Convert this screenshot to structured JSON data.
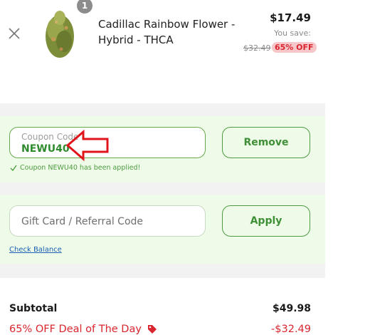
{
  "cart_item": {
    "quantity": "1",
    "title": "Cadillac Rainbow Flower - Hybrid - THCA",
    "price": "$17.49",
    "you_save_label": "You save:",
    "original_price": "$32.49",
    "discount_badge": "65% OFF"
  },
  "coupon": {
    "label": "Coupon Code",
    "value": "NEWU40",
    "button_label": "Remove",
    "applied_message": "Coupon NEWU40 has been applied!"
  },
  "gift_card": {
    "placeholder": "Gift Card / Referral Code",
    "button_label": "Apply",
    "check_balance_link": "Check Balance"
  },
  "totals": {
    "subtotal_label": "Subtotal",
    "subtotal_value": "$49.98",
    "deal_label": "65% OFF Deal of The Day",
    "deal_value": "-$32.49"
  },
  "colors": {
    "accent_green": "#4f9b43",
    "discount_red": "#d9252f",
    "annotation_red": "#e0151b"
  },
  "icons": [
    "close-icon",
    "check-icon",
    "tag-icon",
    "arrow-annotation"
  ]
}
